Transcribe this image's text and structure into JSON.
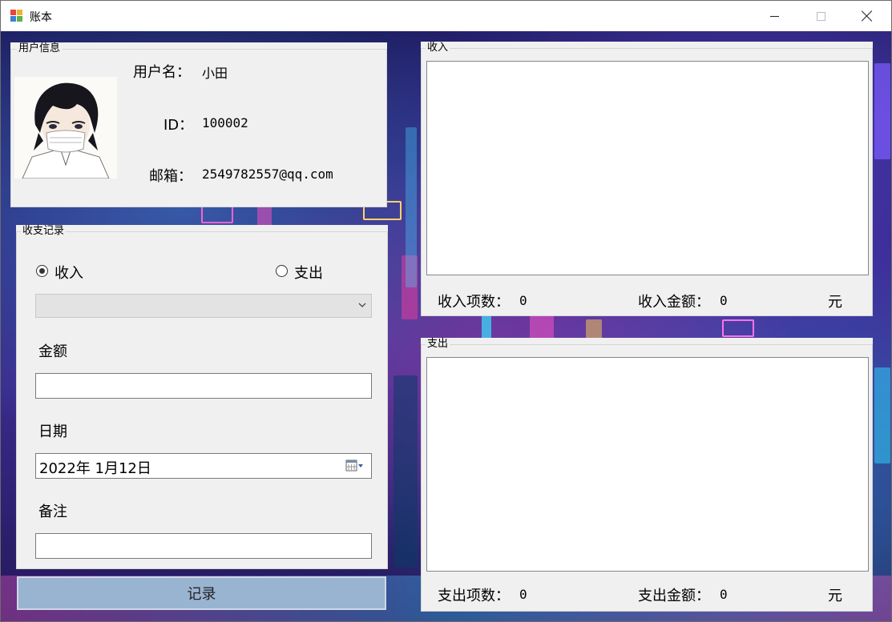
{
  "window": {
    "title": "账本"
  },
  "user_info": {
    "legend": "用户信息",
    "username_label": "用户名：",
    "username_value": "小田",
    "id_label": "ID：",
    "id_value": "100002",
    "email_label": "邮箱：",
    "email_value": "2549782557@qq.com"
  },
  "record": {
    "legend": "收支记录",
    "income_radio": "收入",
    "expense_radio": "支出",
    "income_checked": true,
    "category_value": "",
    "amount_label": "金额",
    "amount_value": "",
    "date_label": "日期",
    "date_value": "2022年  1月12日",
    "note_label": "备注",
    "note_value": "",
    "submit_label": "记录"
  },
  "income_panel": {
    "legend": "收入",
    "count_label": "收入项数：",
    "count_value": "0",
    "amount_label": "收入金额：",
    "amount_value": "0",
    "unit": "元"
  },
  "expense_panel": {
    "legend": "支出",
    "count_label": "支出项数：",
    "count_value": "0",
    "amount_label": "支出金额：",
    "amount_value": "0",
    "unit": "元"
  },
  "colors": {
    "panel_bg": "#f0f0f0",
    "button_bg": "#99b4d1",
    "background_base": "#2b1f7a"
  },
  "icons": {
    "app": "app-icon",
    "minimize": "minimize-icon",
    "maximize": "maximize-icon",
    "close": "close-icon",
    "dropdown": "chevron-down-icon",
    "calendar": "calendar-icon"
  }
}
